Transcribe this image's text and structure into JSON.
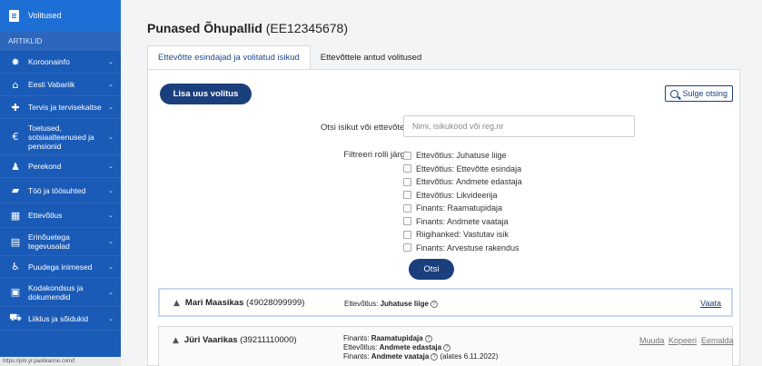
{
  "sidebar": {
    "top_item": "Volitused",
    "heading": "ARTIKLID",
    "items": [
      {
        "label": "Koroonainfo",
        "icon": "virus-icon"
      },
      {
        "label": "Eesti Vabariik",
        "icon": "government-icon"
      },
      {
        "label": "Tervis ja tervisekaitse",
        "icon": "health-icon"
      },
      {
        "label": "Toetused, sotsiaalteenused ja pensionid",
        "icon": "euro-icon"
      },
      {
        "label": "Perekond",
        "icon": "family-icon"
      },
      {
        "label": "Töö ja töösuhted",
        "icon": "briefcase-icon"
      },
      {
        "label": "Ettevõtlus",
        "icon": "building-icon"
      },
      {
        "label": "Erinõuetega tegevusalad",
        "icon": "document-icon"
      },
      {
        "label": "Puudega inimesed",
        "icon": "accessibility-icon"
      },
      {
        "label": "Kodakondsus ja dokumendid",
        "icon": "id-card-icon"
      },
      {
        "label": "Liiklus ja sõidukid",
        "icon": "car-icon"
      }
    ],
    "status_url": "https://pm.yr.paslikanne.com/t"
  },
  "header": {
    "company_name": "Punased Õhupallid",
    "company_code": "(EE12345678)"
  },
  "tabs": [
    {
      "label": "Ettevõtte esindajad ja volitatud isikud",
      "active": true
    },
    {
      "label": "Ettevõttele antud volitused",
      "active": false
    }
  ],
  "toolbar": {
    "add_label": "Lisa uus volitus",
    "close_search_label": "Sulge otsing"
  },
  "search": {
    "label": "Otsi isikut või ettevõtet",
    "placeholder": "Nimi, isikukood või reg.nr",
    "filter_label": "Filtreeri rolli järgi",
    "filters": [
      "Ettevõtlus: Juhatuse liige",
      "Ettevõtlus: Ettevõtte esindaja",
      "Ettevõtlus: Andmete edastaja",
      "Ettevõtlus: Likvideerija",
      "Finants: Raamatupidaja",
      "Finants: Andmete vaataja",
      "Riigihanked: Vastutav isik",
      "Finants: Arvestuse rakendus"
    ],
    "submit_label": "Otsi"
  },
  "results": [
    {
      "name": "Mari Maasikas",
      "id": "(49028099999)",
      "roles": [
        {
          "prefix": "Ettevõtlus: ",
          "role": "Juhatuse liige",
          "suffix": ""
        }
      ],
      "actions": [
        "Vaata"
      ]
    },
    {
      "name": "Jüri Vaarikas",
      "id": "(39211110000)",
      "roles": [
        {
          "prefix": "Finants: ",
          "role": "Raamatupidaja",
          "suffix": ""
        },
        {
          "prefix": "Ettevõtlus: ",
          "role": "Andmete edastaja",
          "suffix": ""
        },
        {
          "prefix": "Finants: ",
          "role": "Andmete vaataja",
          "suffix": " (alates 6.11.2022)"
        }
      ],
      "actions": [
        "Muuda",
        "Kopeeri",
        "Eemalda"
      ]
    }
  ],
  "colors": {
    "sidebar_bg": "#1a5bb8",
    "primary": "#1b3f7d"
  }
}
